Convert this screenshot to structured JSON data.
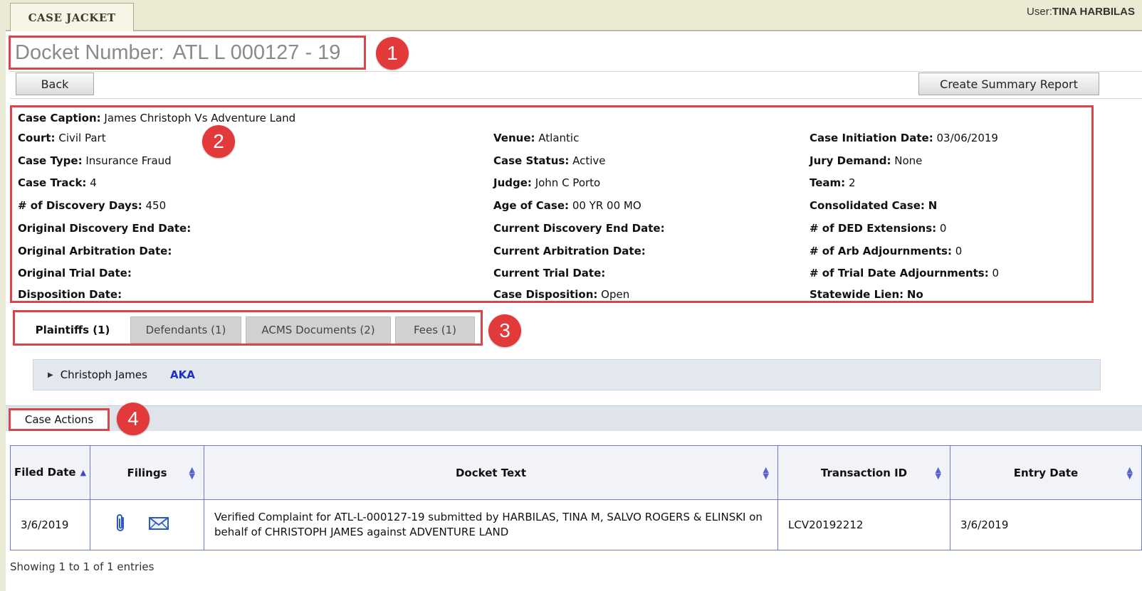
{
  "header": {
    "tab_label": "CASE JACKET",
    "user_label": "User:",
    "user_name": "TINA HARBILAS"
  },
  "docket": {
    "label": "Docket Number:",
    "value": "ATL L 000127 - 19"
  },
  "markers": [
    "1",
    "2",
    "3",
    "4"
  ],
  "buttons": {
    "back": "Back",
    "summary": "Create Summary Report"
  },
  "case": {
    "caption_label": "Case Caption:",
    "caption_value": "James Christoph Vs Adventure Land",
    "col1": [
      {
        "k": "Court:",
        "v": "Civil Part"
      },
      {
        "k": "Case Type:",
        "v": "Insurance Fraud"
      },
      {
        "k": "Case Track:",
        "v": "4"
      },
      {
        "k": "# of Discovery Days:",
        "v": "450"
      },
      {
        "k": "Original Discovery End Date:",
        "v": ""
      },
      {
        "k": "Original Arbitration Date:",
        "v": ""
      },
      {
        "k": "Original Trial Date:",
        "v": ""
      },
      {
        "k": "Disposition Date:",
        "v": ""
      }
    ],
    "col2": [
      {
        "k": "Venue:",
        "v": "Atlantic"
      },
      {
        "k": "Case Status:",
        "v": "Active"
      },
      {
        "k": "Judge:",
        "v": "John C Porto"
      },
      {
        "k": "Age of Case:",
        "v": "00 YR 00 MO"
      },
      {
        "k": "Current Discovery End Date:",
        "v": ""
      },
      {
        "k": "Current Arbitration Date:",
        "v": ""
      },
      {
        "k": "Current Trial Date:",
        "v": ""
      },
      {
        "k": "Case Disposition:",
        "v": "Open"
      }
    ],
    "col3": [
      {
        "k": "Case Initiation Date:",
        "v": "03/06/2019"
      },
      {
        "k": "Jury Demand:",
        "v": "None"
      },
      {
        "k": "Team:",
        "v": "2"
      },
      {
        "k": "Consolidated Case:",
        "v": "N"
      },
      {
        "k": "# of DED Extensions:",
        "v": "0"
      },
      {
        "k": "# of Arb Adjournments:",
        "v": "0"
      },
      {
        "k": "# of Trial Date Adjournments:",
        "v": "0"
      },
      {
        "k": "Statewide Lien:",
        "v": "No"
      }
    ]
  },
  "party_tabs": [
    "Plaintiffs (1)",
    "Defendants (1)",
    "ACMS Documents (2)",
    "Fees (1)"
  ],
  "plaintiff": {
    "name": "Christoph James",
    "aka": "AKA"
  },
  "case_actions": {
    "label": "Case Actions",
    "columns": [
      "Filed Date",
      "Filings",
      "Docket Text",
      "Transaction ID",
      "Entry Date"
    ],
    "rows": [
      {
        "filed_date": "3/6/2019",
        "docket_text": "Verified Complaint for ATL-L-000127-19 submitted by HARBILAS, TINA M, SALVO ROGERS & ELINSKI on behalf of CHRISTOPH JAMES against ADVENTURE LAND",
        "transaction_id": "LCV20192212",
        "entry_date": "3/6/2019"
      }
    ],
    "footer": "Showing 1 to 1 of 1 entries"
  },
  "icons": {
    "attachment": "paperclip-icon",
    "email": "envelope-icon"
  },
  "colors": {
    "highlight_border": "#d9464a",
    "marker": "#e2393a",
    "link": "#1c2fc2",
    "table_border": "#6b7bc4"
  }
}
